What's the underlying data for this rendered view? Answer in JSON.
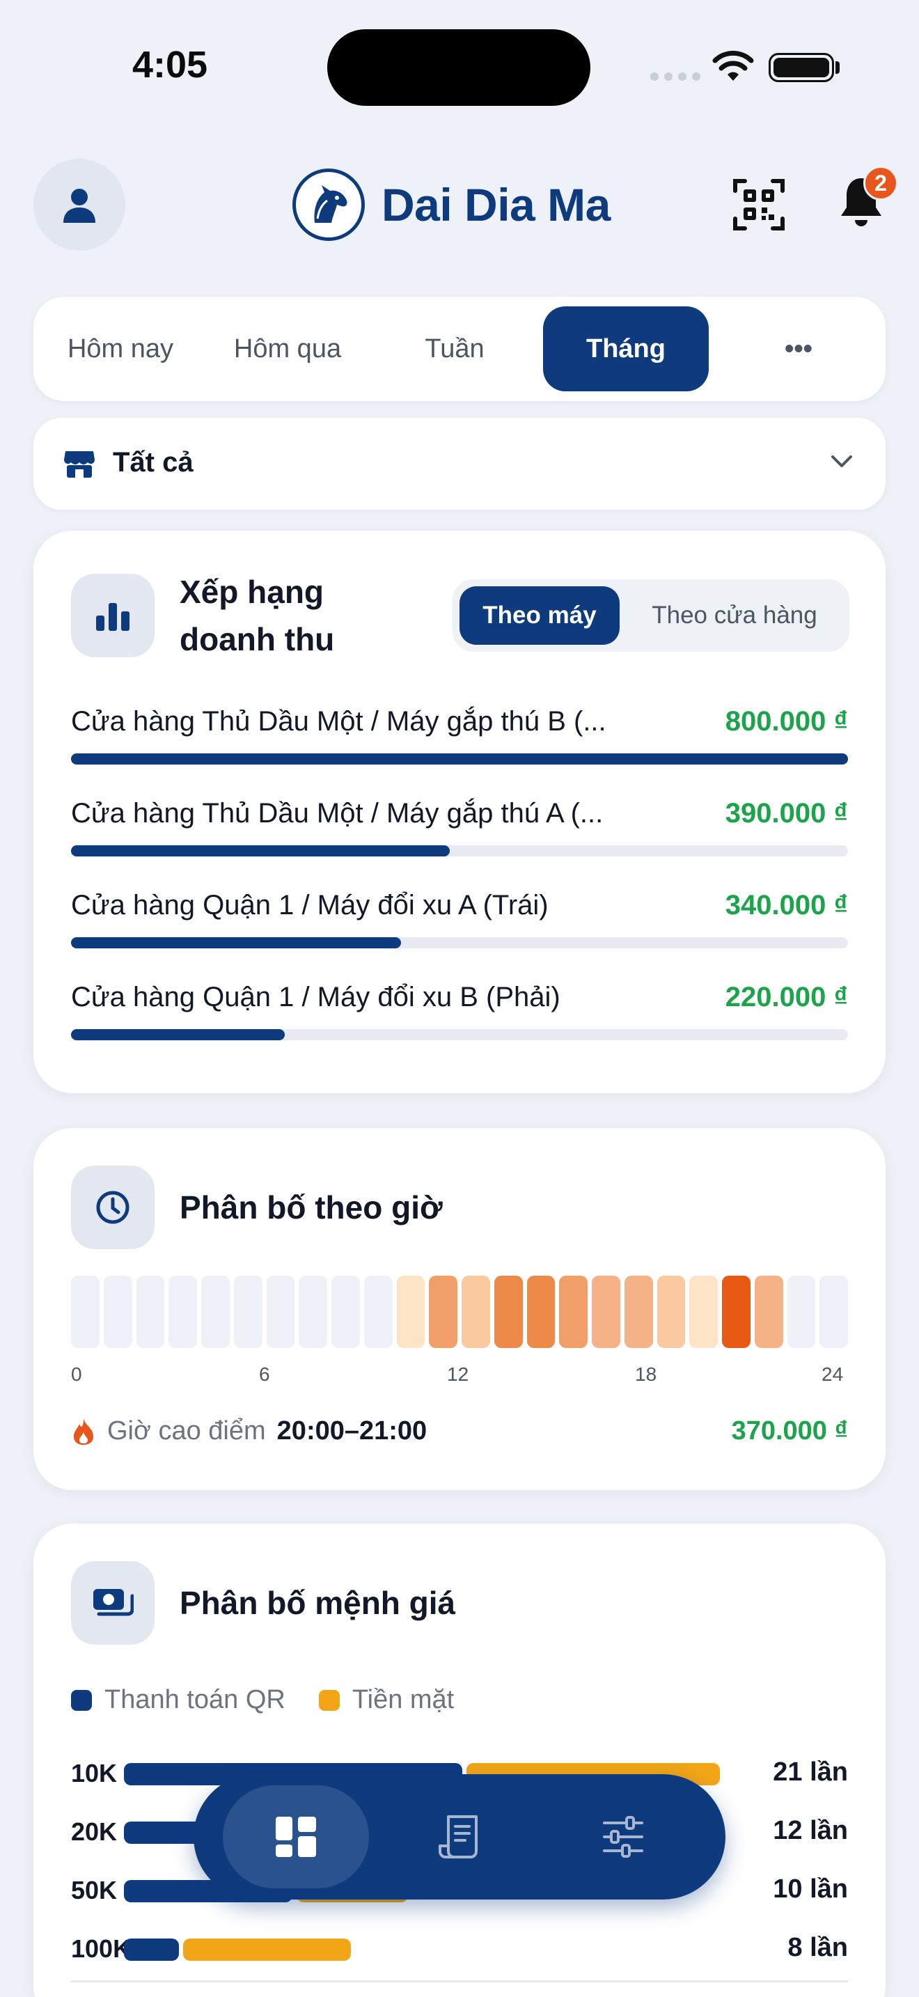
{
  "status_bar": {
    "time": "4:05"
  },
  "header": {
    "brand": "Dai Dia Ma",
    "notification_count": "2"
  },
  "period_tabs": [
    {
      "label": "Hôm nay",
      "active": false
    },
    {
      "label": "Hôm qua",
      "active": false
    },
    {
      "label": "Tuần",
      "active": false
    },
    {
      "label": "Tháng",
      "active": true
    },
    {
      "label": "•••",
      "active": false
    }
  ],
  "store_filter": {
    "label": "Tất cả"
  },
  "revenue_ranking": {
    "title_line1": "Xếp hạng",
    "title_line2": "doanh thu",
    "toggle": [
      {
        "label": "Theo máy",
        "active": true
      },
      {
        "label": "Theo cửa hàng",
        "active": false
      }
    ],
    "items": [
      {
        "name": "Cửa hàng Thủ Dầu Một / Máy gắp thú B (...",
        "value": "800.000 ₫",
        "share": 1.0
      },
      {
        "name": "Cửa hàng Thủ Dầu Một / Máy gắp thú A (...",
        "value": "390.000 ₫",
        "share": 0.4875
      },
      {
        "name": "Cửa hàng Quận 1 / Máy đổi xu A (Trái)",
        "value": "340.000 ₫",
        "share": 0.425
      },
      {
        "name": "Cửa hàng Quận 1 / Máy đổi xu B (Phải)",
        "value": "220.000 ₫",
        "share": 0.275
      }
    ]
  },
  "hourly": {
    "title": "Phân bố theo giờ",
    "ticks": [
      "0",
      "6",
      "12",
      "18",
      "24"
    ],
    "intensity": [
      0,
      0,
      0,
      0,
      0,
      0,
      0,
      0,
      0,
      0,
      1,
      4,
      2,
      5,
      5,
      4,
      3,
      3,
      2,
      1,
      6,
      3,
      0,
      0
    ],
    "colors": [
      "#eef1f7",
      "#fde4c6",
      "#f9c9a0",
      "#f6b287",
      "#f29e68",
      "#ee8a49",
      "#e85a14"
    ],
    "peak_label": "Giờ cao điểm",
    "peak_time": "20:00–21:00",
    "peak_value": "370.000 ₫"
  },
  "denomination": {
    "title": "Phân bố mệnh giá",
    "legend": [
      {
        "label": "Thanh toán QR",
        "color": "#0e3a7e"
      },
      {
        "label": "Tiền mặt",
        "color": "#f2a516"
      }
    ],
    "rows": [
      {
        "label": "10K",
        "count": "21 lần",
        "qr": 12,
        "cash": 9
      },
      {
        "label": "20K",
        "count": "12 lần",
        "qr": 7,
        "cash": 5
      },
      {
        "label": "50K",
        "count": "10 lần",
        "qr": 6,
        "cash": 4
      },
      {
        "label": "100K",
        "count": "8 lần",
        "qr": 2,
        "cash": 6
      }
    ]
  }
}
